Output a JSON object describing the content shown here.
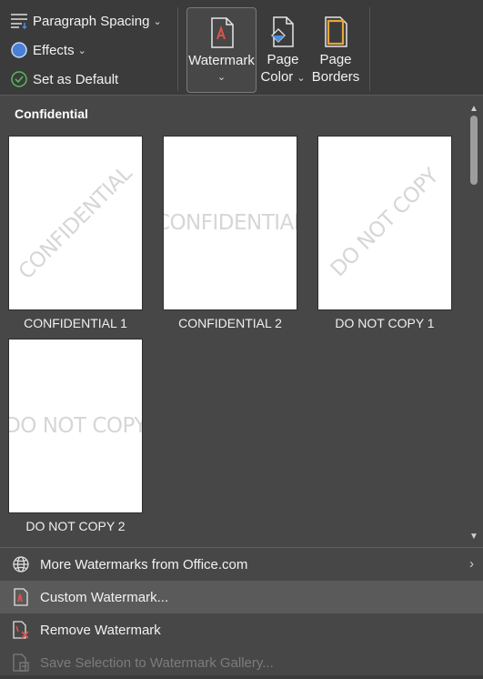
{
  "ribbon": {
    "paragraph_spacing": "Paragraph Spacing",
    "effects": "Effects",
    "set_as_default": "Set as Default",
    "watermark": "Watermark",
    "page_color_line1": "Page",
    "page_color_line2": "Color",
    "page_borders_line1": "Page",
    "page_borders_line2": "Borders"
  },
  "gallery": {
    "section_title": "Confidential",
    "items": [
      {
        "label": "CONFIDENTIAL 1",
        "watermark_text": "CONFIDENTIAL",
        "style": "diagonal"
      },
      {
        "label": "CONFIDENTIAL 2",
        "watermark_text": "CONFIDENTIAL",
        "style": "horizontal"
      },
      {
        "label": "DO NOT COPY 1",
        "watermark_text": "DO NOT COPY",
        "style": "diagonal"
      },
      {
        "label": "DO NOT COPY 2",
        "watermark_text": "DO NOT COPY",
        "style": "horizontal"
      }
    ]
  },
  "menu": {
    "more_watermarks": "More Watermarks from Office.com",
    "custom_watermark": "Custom Watermark...",
    "remove_watermark": "Remove Watermark",
    "save_selection": "Save Selection to Watermark Gallery..."
  },
  "icons": {
    "paragraph_spacing": "paragraph-spacing-icon",
    "effects": "effects-icon",
    "set_as_default": "checkmark-circle-icon",
    "watermark": "watermark-icon",
    "page_color": "page-color-icon",
    "page_borders": "page-borders-icon",
    "globe": "globe-icon",
    "custom_watermark": "document-watermark-icon",
    "remove_watermark": "remove-watermark-icon",
    "save_selection": "save-to-gallery-icon"
  },
  "colors": {
    "background": "#3b3b3b",
    "panel": "#474747",
    "accent_red": "#c0392b",
    "accent_blue": "#4a90d9",
    "accent_orange": "#e8a33b",
    "check_green": "#5cb85c"
  }
}
